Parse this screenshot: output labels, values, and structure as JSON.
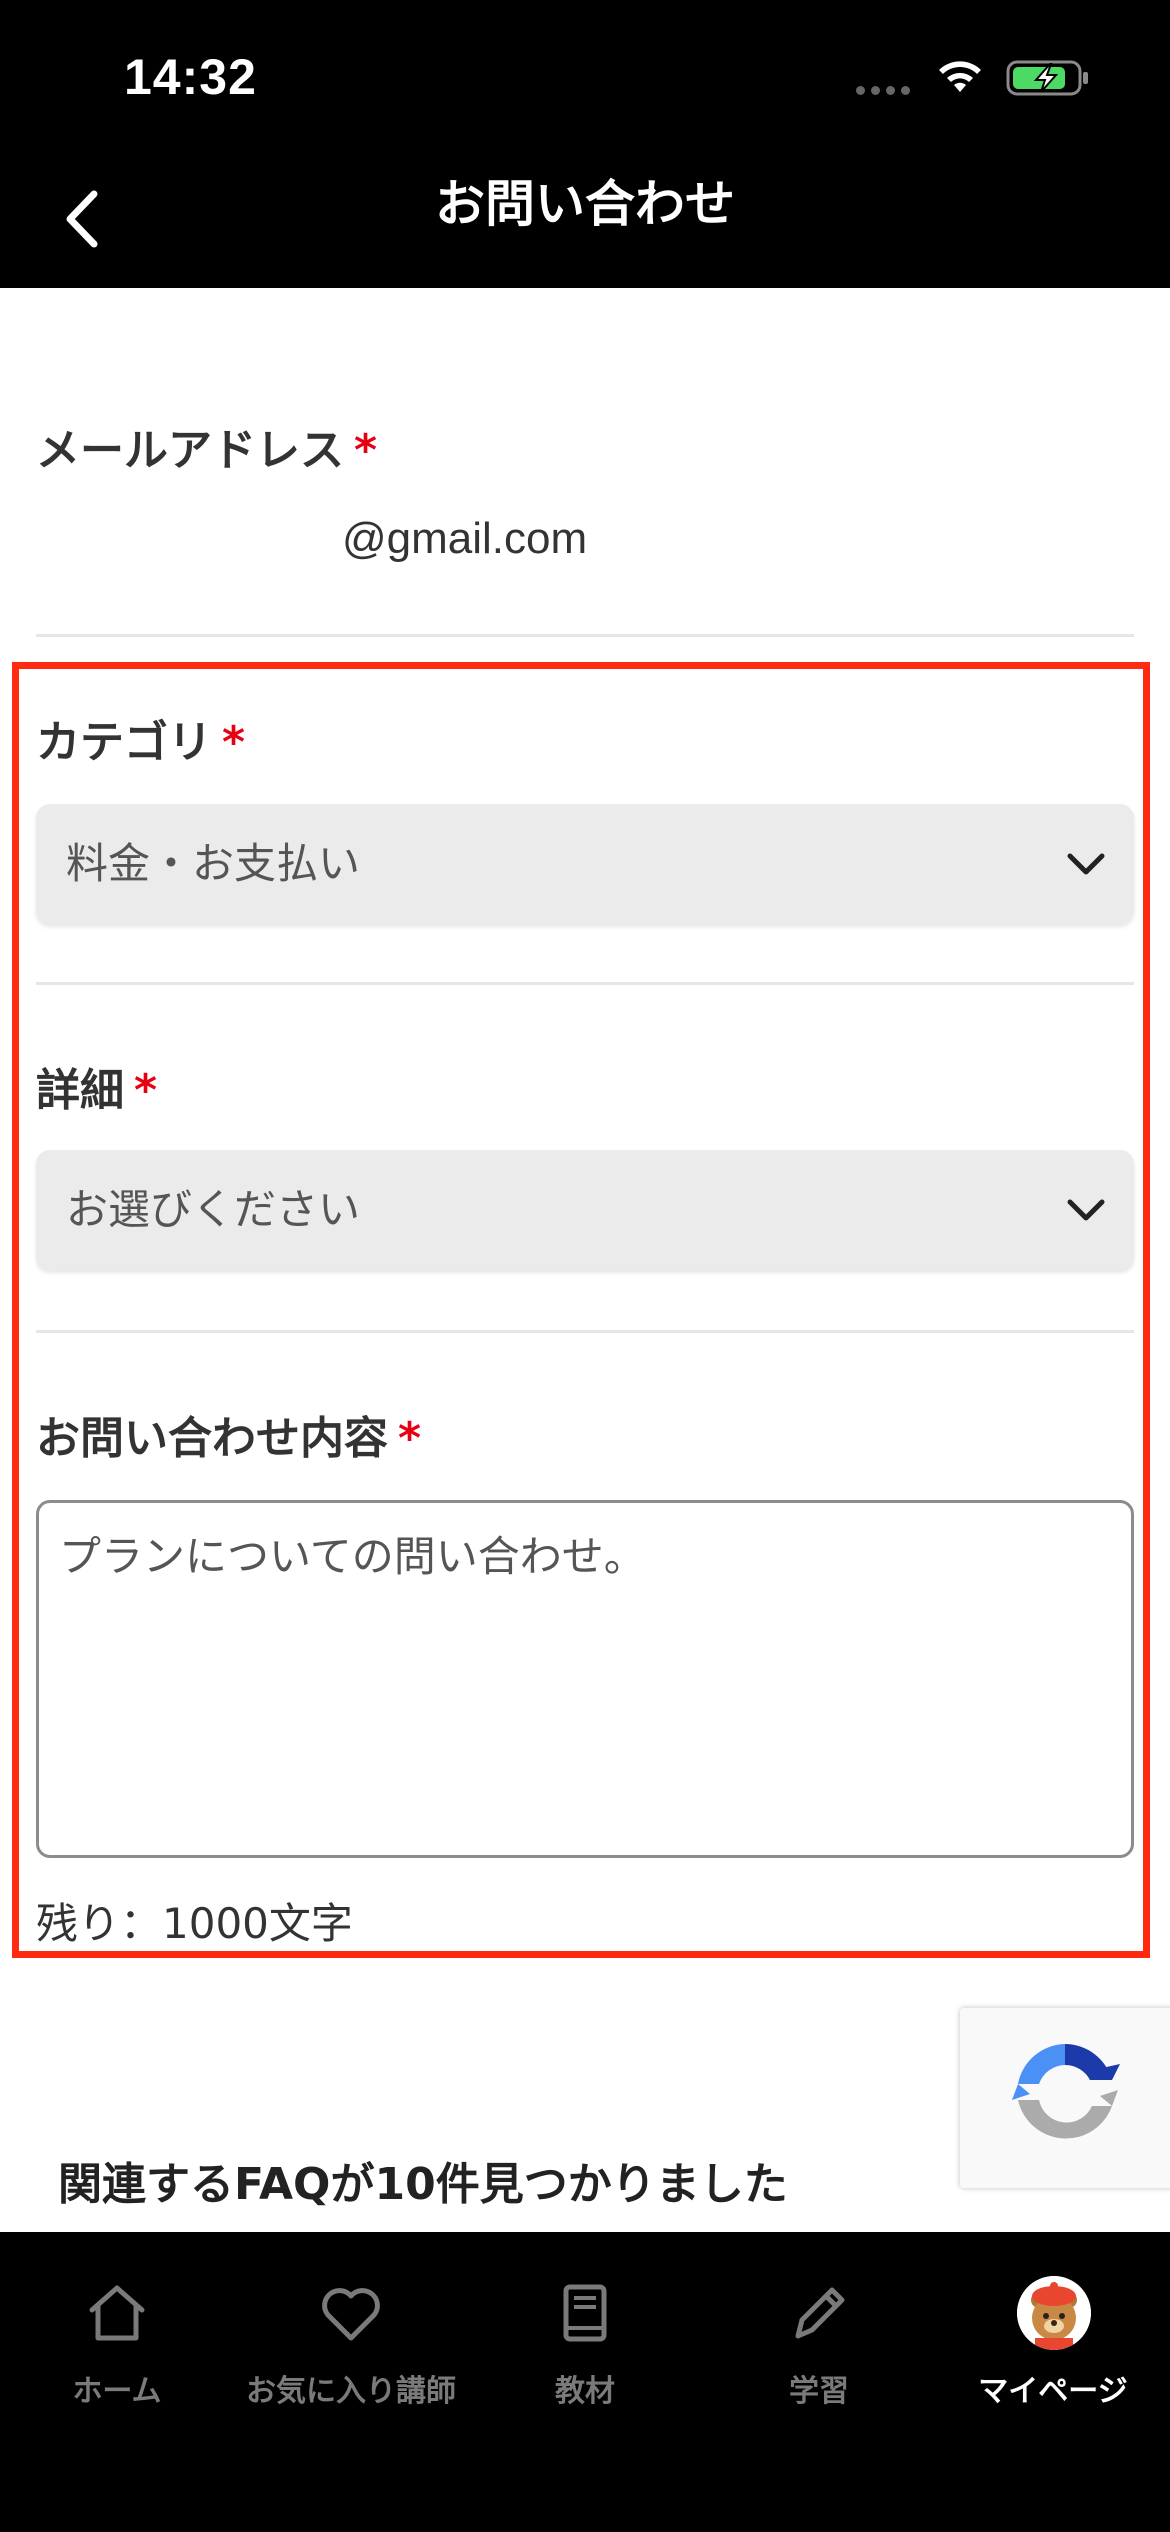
{
  "status_bar": {
    "time": "14:32",
    "icons": [
      "signal-icon",
      "wifi-icon",
      "battery-charging-icon"
    ],
    "battery_color": "#4cd964"
  },
  "nav": {
    "title": "お問い合わせ",
    "back_icon": "chevron-left-icon"
  },
  "form": {
    "email": {
      "label": "メールアドレス",
      "required_mark": "*",
      "value": "@gmail.com"
    },
    "category": {
      "label": "カテゴリ",
      "required_mark": "*",
      "selected": "料金・お支払い"
    },
    "detail": {
      "label": "詳細",
      "required_mark": "*",
      "selected": "お選びください"
    },
    "inquiry": {
      "label": "お問い合わせ内容",
      "required_mark": "*",
      "value": "プランについての問い合わせ。",
      "remaining": "残り：1000文字"
    }
  },
  "faq": {
    "heading": "関連するFAQが10件見つかりました"
  },
  "tabs": [
    {
      "label": "ホーム",
      "icon": "home-icon",
      "active": false
    },
    {
      "label": "お気に入り講師",
      "icon": "heart-icon",
      "active": false
    },
    {
      "label": "教材",
      "icon": "book-icon",
      "active": false
    },
    {
      "label": "学習",
      "icon": "pencil-icon",
      "active": false
    },
    {
      "label": "マイページ",
      "icon": "bear-avatar-icon",
      "active": true
    }
  ],
  "colors": {
    "header_bg": "#000000",
    "required": "#e60012",
    "highlight": "#ff2a0f",
    "select_bg": "#ebebeb"
  }
}
